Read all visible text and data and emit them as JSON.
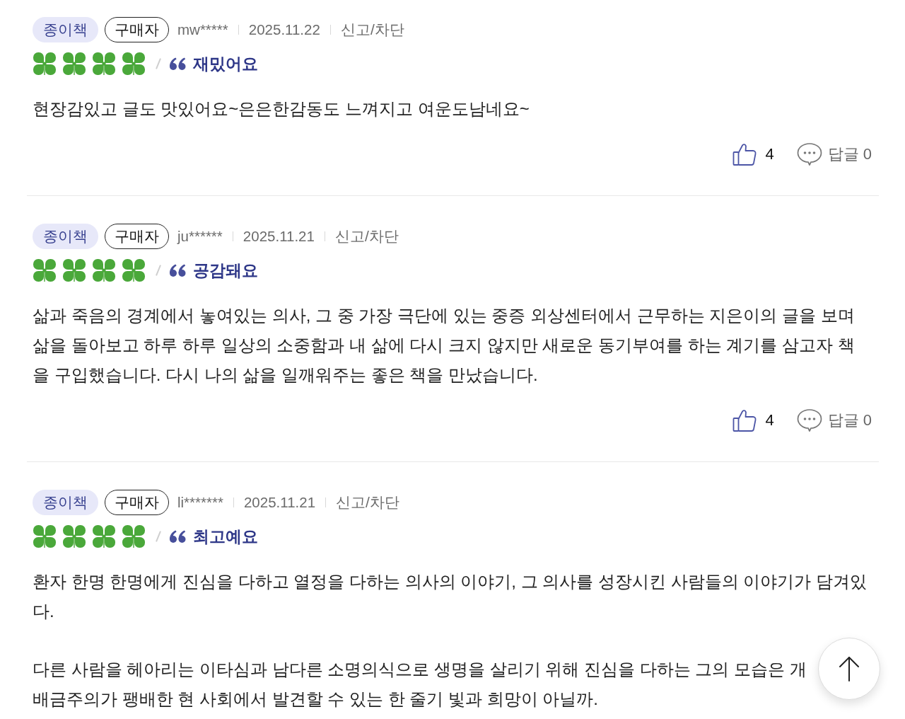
{
  "reviews": [
    {
      "format": "종이책",
      "buyer": "구매자",
      "user": "mw*****",
      "date": "2025.11.22",
      "report": "신고/차단",
      "stars": 4,
      "headline": "재밌어요",
      "paragraphs": [
        "현장감있고 글도 맛있어요~은은한감동도 느껴지고 여운도남네요~"
      ],
      "likes": "4",
      "replies": "답글 0"
    },
    {
      "format": "종이책",
      "buyer": "구매자",
      "user": "ju******",
      "date": "2025.11.21",
      "report": "신고/차단",
      "stars": 4,
      "headline": "공감돼요",
      "paragraphs": [
        "삶과 죽음의 경계에서 놓여있는 의사, 그 중 가장 극단에 있는 중증 외상센터에서 근무하는 지은이의 글을 보며 삶을 돌아보고 하루 하루 일상의 소중함과 내 삶에 다시 크지 않지만 새로운 동기부여를 하는 계기를 삼고자 책을 구입했습니다. 다시 나의 삶을 일깨워주는 좋은 책을 만났습니다."
      ],
      "likes": "4",
      "replies": "답글 0"
    },
    {
      "format": "종이책",
      "buyer": "구매자",
      "user": "li*******",
      "date": "2025.11.21",
      "report": "신고/차단",
      "stars": 4,
      "headline": "최고예요",
      "paragraphs": [
        "환자 한명 한명에게 진심을 다하고 열정을 다하는 의사의 이야기, 그 의사를 성장시킨 사람들의 이야기가 담겨있다.",
        "다른 사람을 헤아리는 이타심과 남다른 소명의식으로 생명을 살리기 위해 진심을 다하는 그의 모습은 개\n배금주의가 팽배한 현 사회에서 발견할 수 있는 한 줄기 빛과 희망이 아닐까."
      ]
    }
  ]
}
